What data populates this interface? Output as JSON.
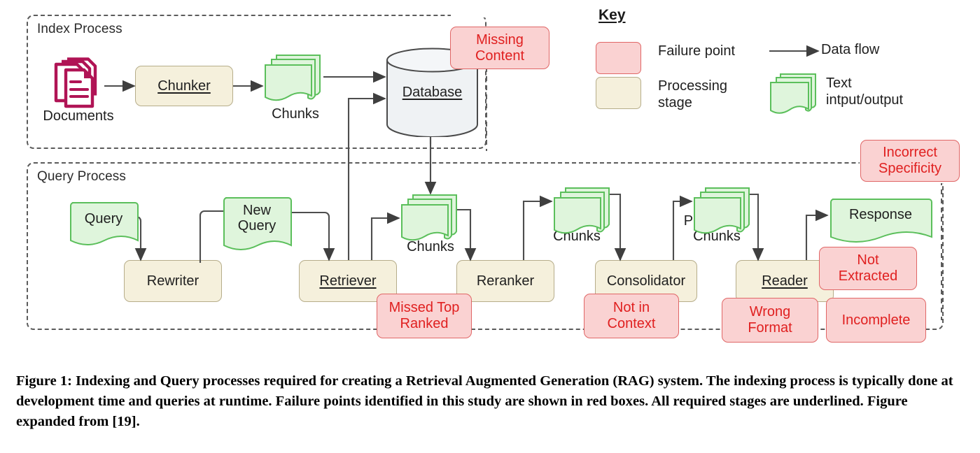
{
  "figure": {
    "caption": "Figure 1: Indexing and Query processes required for creating a Retrieval Augmented Generation (RAG) system. The indexing process is typically done at development time and queries at runtime. Failure points identified in this study are shown in red boxes. All required stages are underlined. Figure expanded from [19]."
  },
  "colors": {
    "failure_fill": "#FAD2D2",
    "failure_border": "#E06666",
    "failure_text": "#E02020",
    "stage_fill": "#F5F0DC",
    "stage_border": "#B6AD8A",
    "text_shape_fill": "#DFF5DC",
    "text_shape_border": "#5BBF5B",
    "documents_icon": "#B01455",
    "database_fill": "#EFF2F4",
    "arrow": "#4D4D4D",
    "dashed_group": "#5B5B5B"
  },
  "groups": [
    {
      "id": "index-process",
      "label": "Index Process"
    },
    {
      "id": "query-process",
      "label": "Query Process"
    }
  ],
  "index_process": {
    "documents_label": "Documents",
    "chunker": {
      "label": "Chunker",
      "required": true
    },
    "chunks_caption": "Chunks",
    "database": {
      "label": "Database",
      "required": true
    },
    "failure": {
      "label": "Missing\nContent"
    }
  },
  "query_process": {
    "query_shape": "Query",
    "rewriter": {
      "label": "Rewriter",
      "required": false
    },
    "new_query_shape": "New\nQuery",
    "retriever": {
      "label": "Retriever",
      "required": true
    },
    "chunks_caption": "Chunks",
    "reranker": {
      "label": "Reranker",
      "required": false
    },
    "ranked_chunks_caption": "Ranked\nChunks",
    "consolidator": {
      "label": "Consolidator",
      "required": false
    },
    "processed_chunks_caption": "Processed\nChunks",
    "reader": {
      "label": "Reader",
      "required": true
    },
    "response_shape": "Response",
    "failures": [
      {
        "id": "missed-top-ranked",
        "label": "Missed Top\nRanked"
      },
      {
        "id": "not-in-context",
        "label": "Not in\nContext"
      },
      {
        "id": "not-extracted",
        "label": "Not\nExtracted"
      },
      {
        "id": "wrong-format",
        "label": "Wrong\nFormat"
      },
      {
        "id": "incomplete",
        "label": "Incomplete"
      },
      {
        "id": "incorrect-specificity",
        "label": "Incorrect\nSpecificity"
      }
    ]
  },
  "key": {
    "title": "Key",
    "entries": [
      {
        "id": "failure-point",
        "label": "Failure point",
        "swatch": "red-box"
      },
      {
        "id": "processing-stage",
        "label": "Processing\nstage",
        "swatch": "tan-box"
      },
      {
        "id": "data-flow",
        "label": "Data flow",
        "swatch": "arrow-icon"
      },
      {
        "id": "text-io",
        "label": "Text\nintput/output",
        "swatch": "text-shape-icon"
      }
    ]
  }
}
